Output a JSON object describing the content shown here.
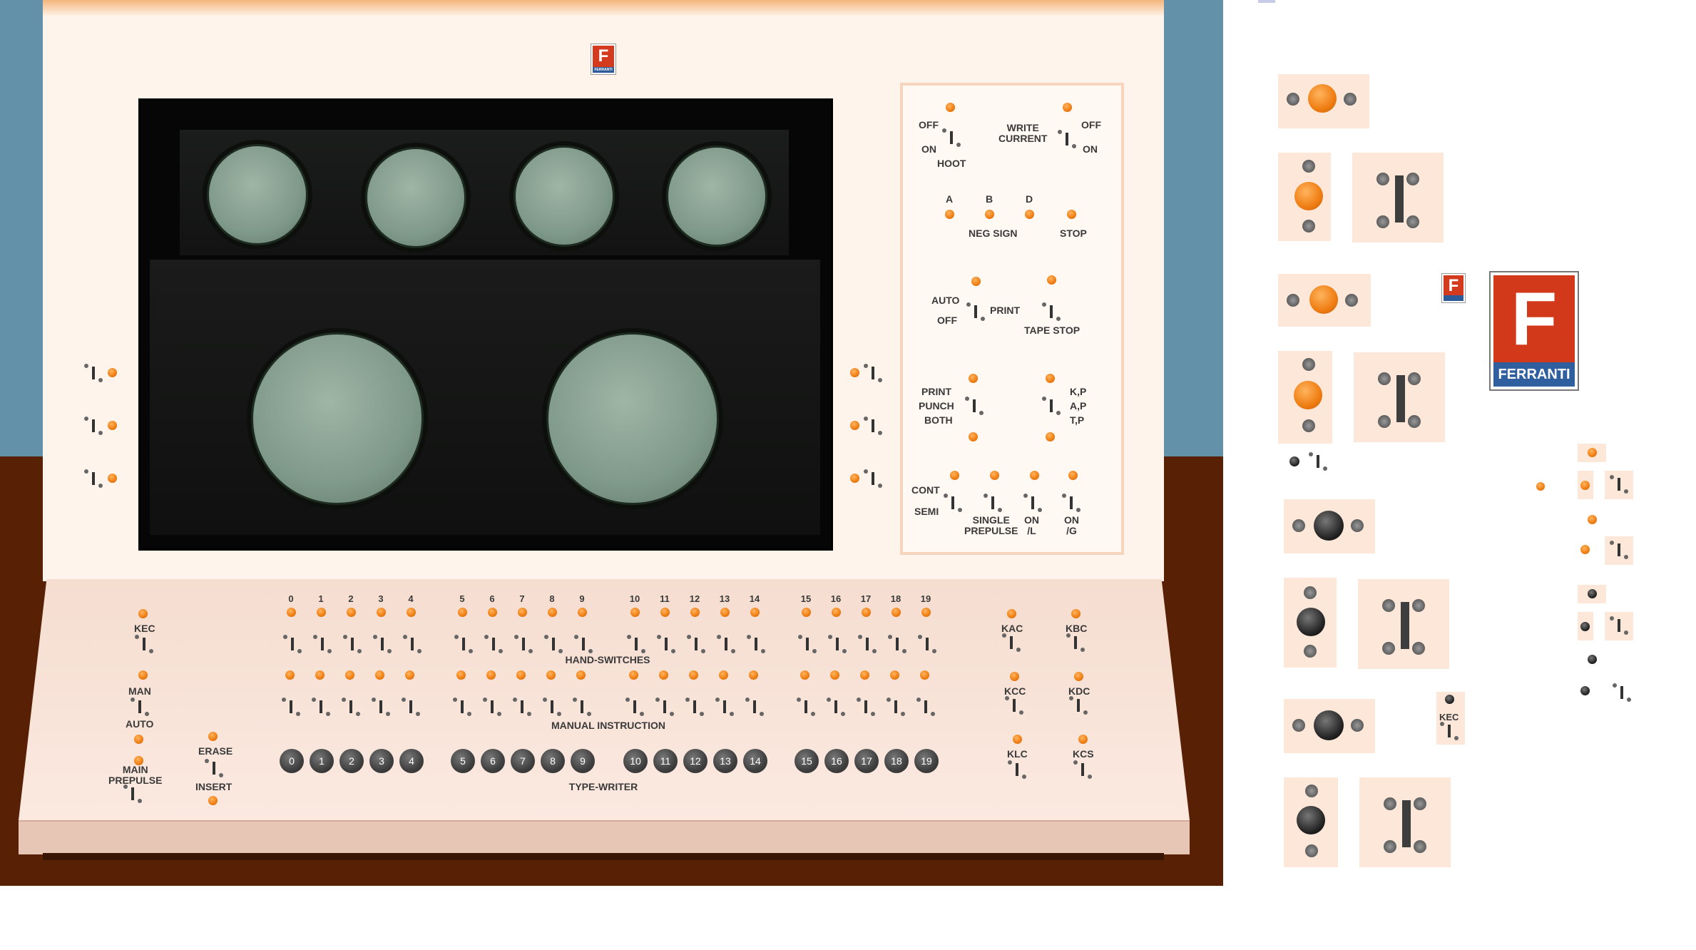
{
  "logo": {
    "letter": "F",
    "brand": "FERRANTI"
  },
  "control_panel": {
    "hoot": {
      "off": "OFF",
      "on": "ON",
      "name": "HOOT"
    },
    "write_current": {
      "name": "WRITE\nCURRENT",
      "off": "OFF",
      "on": "ON"
    },
    "neg_sign": {
      "a": "A",
      "b": "B",
      "d": "D",
      "name": "NEG SIGN",
      "stop": "STOP"
    },
    "print": {
      "auto": "AUTO",
      "off": "OFF",
      "name": "PRINT",
      "tape_stop": "TAPE STOP"
    },
    "output": {
      "print": "PRINT",
      "punch": "PUNCH",
      "both": "BOTH",
      "kp": "K,P",
      "ap": "A,P",
      "tp": "T,P"
    },
    "run": {
      "cont": "CONT",
      "semi": "SEMI",
      "single_prepulse": "SINGLE\nPREPULSE",
      "on_l": "ON\n/L",
      "on_g": "ON\n/G"
    }
  },
  "desk": {
    "kec": "KEC",
    "man": "MAN",
    "auto": "AUTO",
    "main_prepulse": "MAIN\nPREPULSE",
    "erase": "ERASE",
    "insert": "INSERT",
    "hand_switches": "HAND-SWITCHES",
    "manual_instruction": "MANUAL INSTRUCTION",
    "type_writer": "TYPE-WRITER",
    "digit_labels": [
      "0",
      "1",
      "2",
      "3",
      "4",
      "5",
      "6",
      "7",
      "8",
      "9",
      "10",
      "11",
      "12",
      "13",
      "14",
      "15",
      "16",
      "17",
      "18",
      "19"
    ],
    "right_labels": {
      "kac": "KAC",
      "kbc": "KBC",
      "kcc": "KCC",
      "kdc": "KDC",
      "klc": "KLC",
      "kcs": "KCS"
    }
  },
  "sprites": {
    "kec": "KEC"
  }
}
